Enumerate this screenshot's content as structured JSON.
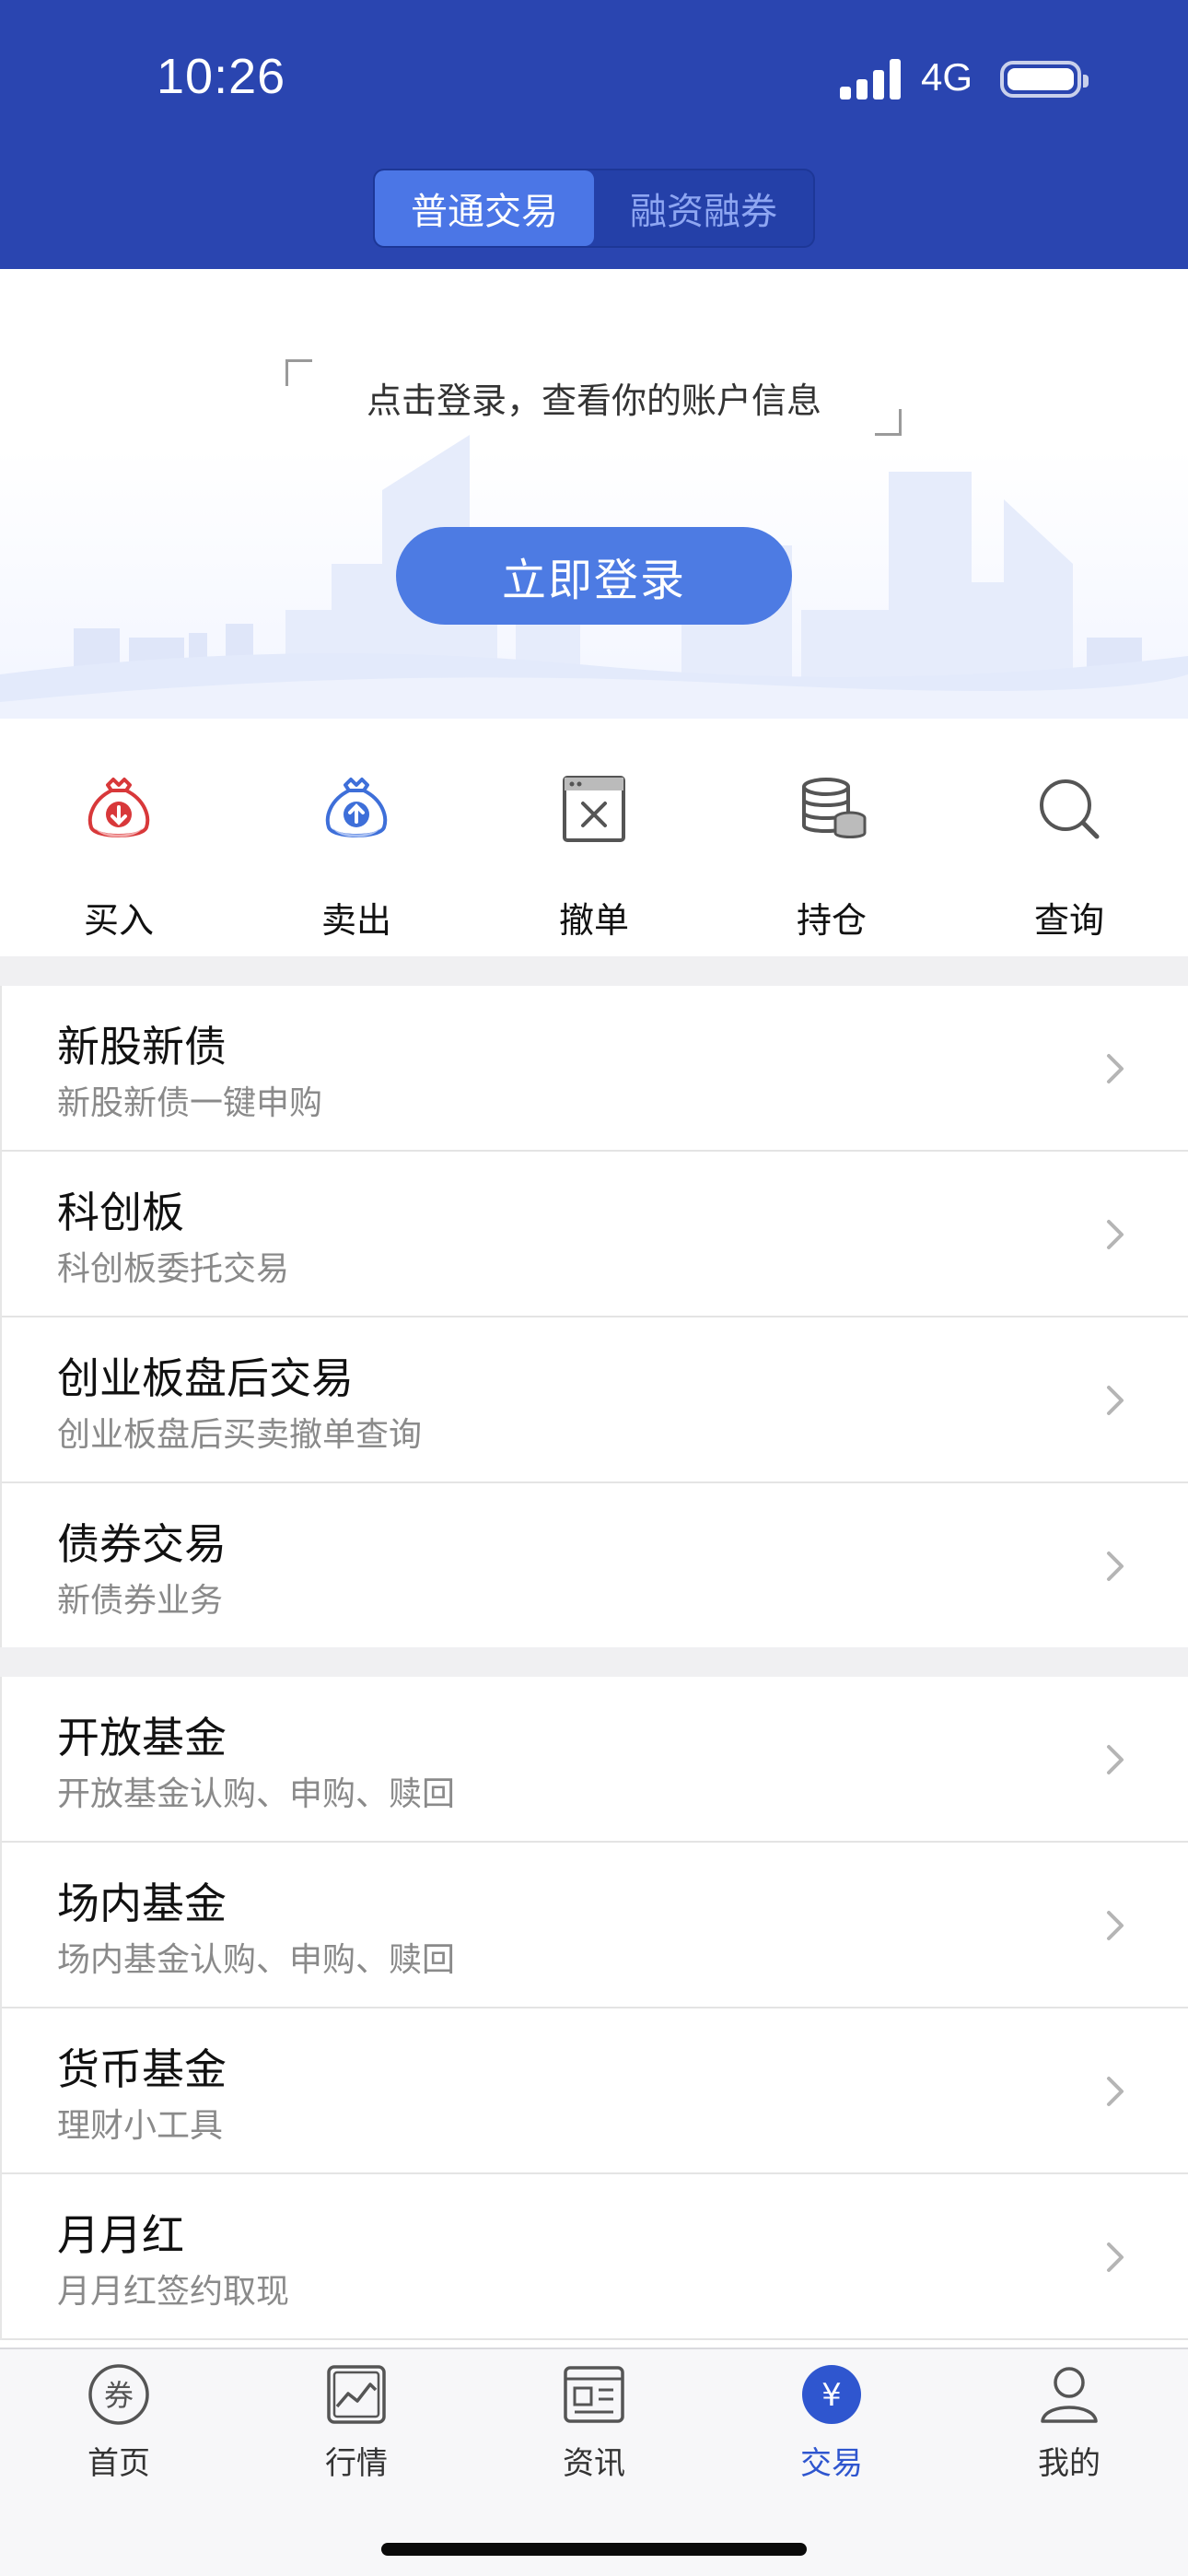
{
  "status_bar": {
    "time": "10:26",
    "network": "4G"
  },
  "header": {
    "segments": [
      {
        "label": "普通交易",
        "active": true
      },
      {
        "label": "融资融券",
        "active": false
      }
    ]
  },
  "login": {
    "hint": "点击登录，查看你的账户信息",
    "button": "立即登录"
  },
  "quick_actions": [
    {
      "label": "买入",
      "icon": "buy-bag-icon"
    },
    {
      "label": "卖出",
      "icon": "sell-bag-icon"
    },
    {
      "label": "撤单",
      "icon": "cancel-order-icon"
    },
    {
      "label": "持仓",
      "icon": "coins-stack-icon"
    },
    {
      "label": "查询",
      "icon": "search-icon"
    }
  ],
  "section1": [
    {
      "title": "新股新债",
      "subtitle": "新股新债一键申购"
    },
    {
      "title": "科创板",
      "subtitle": "科创板委托交易"
    },
    {
      "title": "创业板盘后交易",
      "subtitle": "创业板盘后买卖撤单查询"
    },
    {
      "title": "债券交易",
      "subtitle": "新债券业务"
    }
  ],
  "section2": [
    {
      "title": "开放基金",
      "subtitle": "开放基金认购、申购、赎回"
    },
    {
      "title": "场内基金",
      "subtitle": "场内基金认购、申购、赎回"
    },
    {
      "title": "货币基金",
      "subtitle": "理财小工具"
    },
    {
      "title": "月月红",
      "subtitle": "月月红签约取现"
    }
  ],
  "tabs": [
    {
      "label": "首页",
      "icon": "quan-coin-icon"
    },
    {
      "label": "行情",
      "icon": "market-chart-icon"
    },
    {
      "label": "资讯",
      "icon": "news-icon"
    },
    {
      "label": "交易",
      "icon": "yen-icon",
      "active": true,
      "badge": "¥"
    },
    {
      "label": "我的",
      "icon": "user-icon"
    }
  ],
  "home_tab_glyph": "券",
  "colors": {
    "header": "#2a45b0",
    "accent": "#4d7be3",
    "buy": "#d8383a",
    "sell": "#3e6fd9",
    "tab_active": "#2f56cf"
  }
}
